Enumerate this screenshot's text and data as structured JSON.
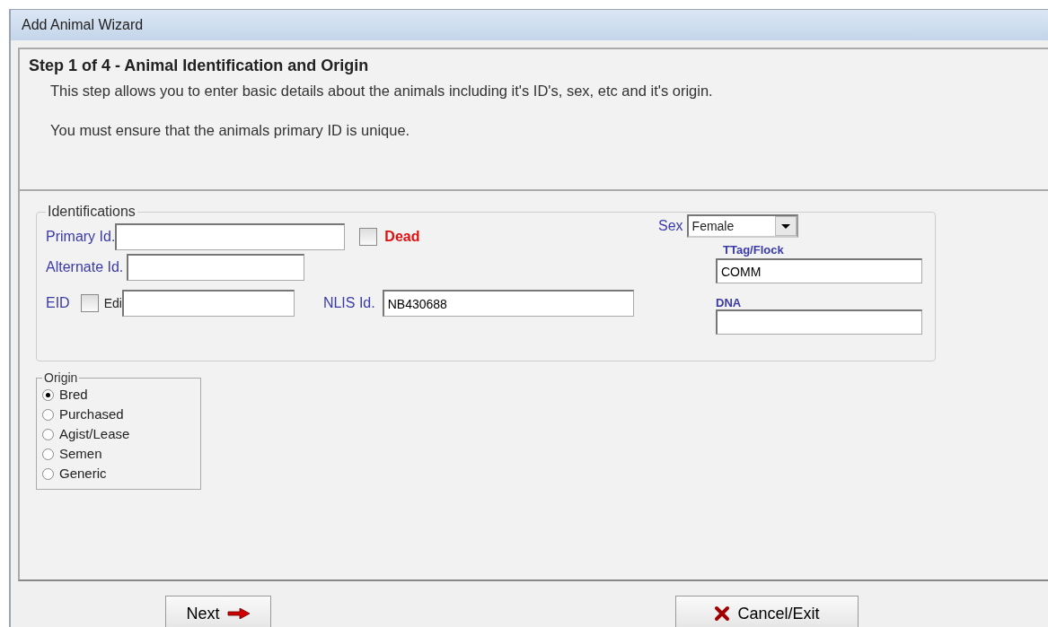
{
  "window": {
    "title": "Add Animal Wizard"
  },
  "step": {
    "title": "Step 1 of 4 - Animal Identification and Origin",
    "description": "This step allows you to enter basic details about the animals including it's ID's, sex, etc and it's origin.",
    "note": "You must ensure that the animals primary ID is unique."
  },
  "identifications": {
    "legend": "Identifications",
    "primary_id": {
      "label": "Primary Id."
    },
    "dead": {
      "label": "Dead",
      "checked": false
    },
    "alternate_id": {
      "label": "Alternate Id."
    },
    "eid": {
      "label": "EID",
      "checked": false,
      "edit_label": "Edi"
    },
    "nlis_id": {
      "label": "NLIS Id.",
      "value": "NB430688"
    },
    "sex": {
      "label": "Sex",
      "value": "Female"
    },
    "ttag_flock": {
      "label": "TTag/Flock",
      "value": "COMM"
    },
    "dna": {
      "label": "DNA"
    }
  },
  "origin": {
    "legend": "Origin",
    "options": [
      {
        "label": "Bred",
        "selected": true
      },
      {
        "label": "Purchased",
        "selected": false
      },
      {
        "label": "Agist/Lease",
        "selected": false
      },
      {
        "label": "Semen",
        "selected": false
      },
      {
        "label": "Generic",
        "selected": false
      }
    ]
  },
  "buttons": {
    "next": "Next",
    "cancel": "Cancel/Exit"
  }
}
